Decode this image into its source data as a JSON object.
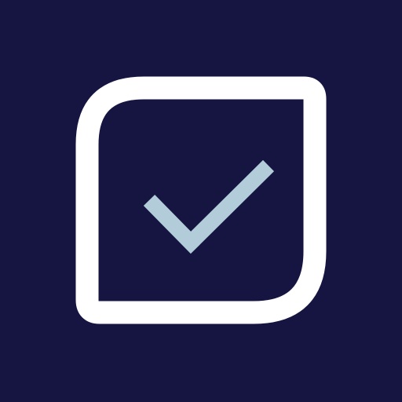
{
  "app_icon": {
    "icon_name": "checkbox-checked-icon",
    "colors": {
      "background": "#161542",
      "frame": "#ffffff",
      "checkmark": "#b2ccda"
    }
  }
}
